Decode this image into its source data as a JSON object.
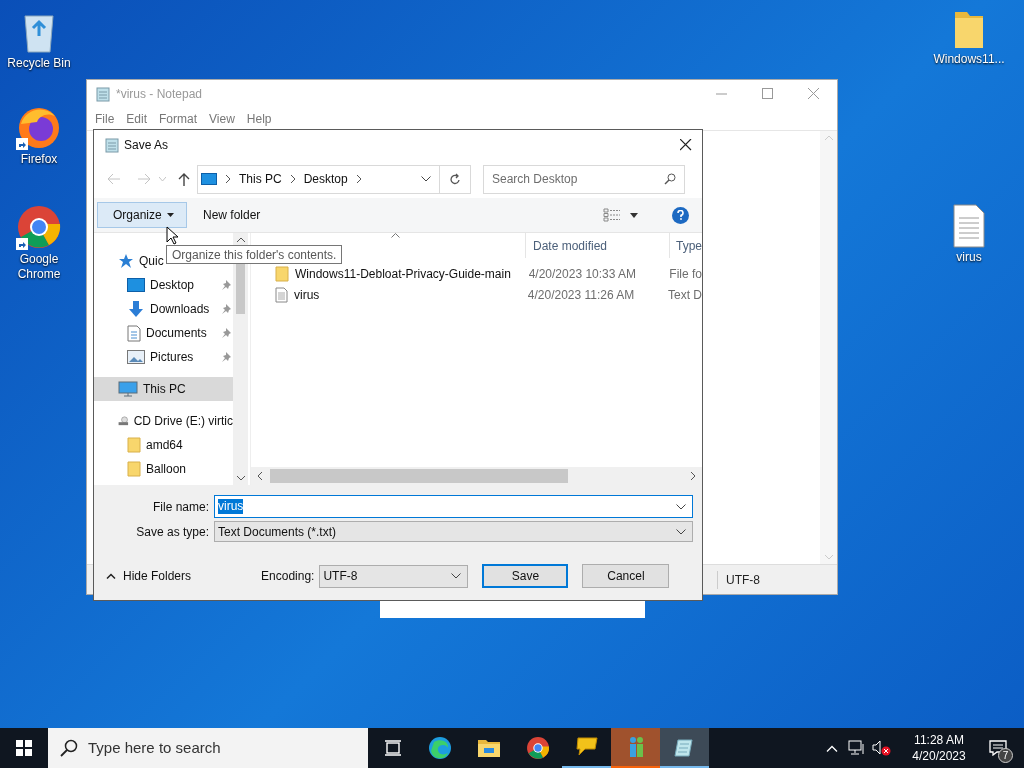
{
  "desktop_icons": [
    {
      "label": "Recycle Bin",
      "kind": "recycle",
      "shortcut": false
    },
    {
      "label": "Firefox",
      "kind": "firefox",
      "shortcut": true
    },
    {
      "label": "Google Chrome",
      "kind": "chrome",
      "shortcut": true
    },
    {
      "label": "Windows11...",
      "kind": "folder",
      "shortcut": false
    },
    {
      "label": "virus",
      "kind": "text",
      "shortcut": false
    }
  ],
  "notepad": {
    "title": "*virus - Notepad",
    "menu": [
      "File",
      "Edit",
      "Format",
      "View",
      "Help"
    ],
    "status_encoding": "UTF-8"
  },
  "save_dialog": {
    "title": "Save As",
    "breadcrumb": [
      "This PC",
      "Desktop"
    ],
    "search": {
      "placeholder": "Search Desktop"
    },
    "toolbar": {
      "organize": "Organize",
      "new_folder": "New folder"
    },
    "tooltip": "Organize this folder's contents.",
    "nav": [
      {
        "label": "Quic",
        "kind": "star",
        "pinned": false,
        "selected": false,
        "children": [
          {
            "label": "Desktop",
            "kind": "desktop",
            "pinned": true,
            "selected": false
          },
          {
            "label": "Downloads",
            "kind": "download",
            "pinned": true,
            "selected": false
          },
          {
            "label": "Documents",
            "kind": "document",
            "pinned": true,
            "selected": false
          },
          {
            "label": "Pictures",
            "kind": "pictures",
            "pinned": true,
            "selected": false
          }
        ]
      },
      {
        "label": "This PC",
        "kind": "pc",
        "pinned": false,
        "selected": true
      },
      {
        "label": "CD Drive (E:) virtic",
        "kind": "drive",
        "pinned": false,
        "selected": false,
        "children": [
          {
            "label": "amd64",
            "kind": "folder",
            "pinned": false,
            "selected": false
          },
          {
            "label": "Balloon",
            "kind": "folder",
            "pinned": false,
            "selected": false
          }
        ]
      }
    ],
    "columns": [
      "Date modified",
      "Type"
    ],
    "files": [
      {
        "name": "Windows11-Debloat-Privacy-Guide-main",
        "kind": "folder",
        "date": "4/20/2023 10:33 AM",
        "type": "File fo"
      },
      {
        "name": "virus",
        "kind": "text",
        "date": "4/20/2023 11:26 AM",
        "type": "Text D"
      }
    ],
    "file_name": {
      "label": "File name:",
      "value": "virus"
    },
    "save_as_type": {
      "label": "Save as type:",
      "value": "Text Documents (*.txt)"
    },
    "hide_folders": "Hide Folders",
    "encoding": {
      "label": "Encoding:",
      "value": "UTF-8"
    },
    "buttons": [
      "Save",
      "Cancel"
    ]
  },
  "taskbar": {
    "search": {
      "placeholder": "Type here to search"
    },
    "apps": [
      {
        "kind": "taskview",
        "open": false,
        "attention": false,
        "active": false
      },
      {
        "kind": "edge",
        "open": false,
        "attention": false,
        "active": false
      },
      {
        "kind": "explorer",
        "open": false,
        "attention": false,
        "active": false
      },
      {
        "kind": "chrome",
        "open": false,
        "attention": false,
        "active": false
      },
      {
        "kind": "chat",
        "open": true,
        "attention": false,
        "active": false
      },
      {
        "kind": "people",
        "open": true,
        "attention": true,
        "active": false
      },
      {
        "kind": "notepad",
        "open": true,
        "attention": false,
        "active": true
      }
    ],
    "clock": {
      "time": "11:28 AM",
      "date": "4/20/2023"
    },
    "notifications": "7"
  }
}
